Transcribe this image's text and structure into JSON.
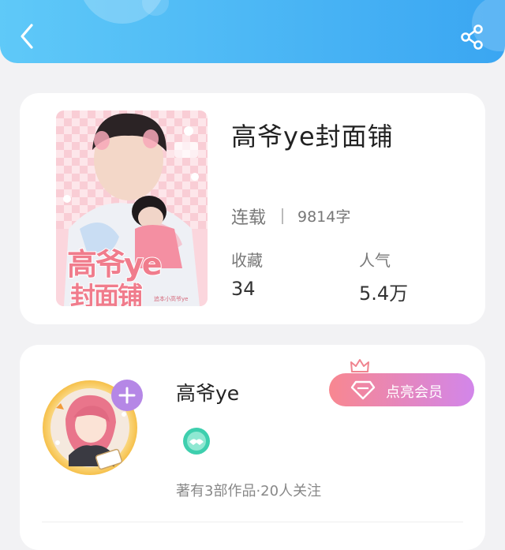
{
  "nav": {
    "back_icon": "chevron-left-icon",
    "share_icon": "share-icon"
  },
  "book": {
    "title": "高爷ye封面铺",
    "cover_text_line1": "高爷ye",
    "cover_text_line2": "封面铺",
    "cover_small_text": "追本小高爷ye",
    "status": "连载",
    "word_count": "9814字",
    "favorites_label": "收藏",
    "favorites_value": "34",
    "popularity_label": "人气",
    "popularity_value": "5.4万"
  },
  "author": {
    "name": "高爷ye",
    "vip_label": "点亮会员",
    "stats": "著有3部作品·20人关注",
    "follow_icon": "plus-icon",
    "badge_icon": "handshake-badge-icon",
    "crown_icon": "crown-icon",
    "vip_icon": "diamond-icon"
  },
  "colors": {
    "header_start": "#5fc9f8",
    "header_end": "#3aa6f2",
    "vip_start": "#f88790",
    "vip_end": "#d286ea",
    "follow": "#b587e6",
    "badge": "#3ecfae"
  }
}
